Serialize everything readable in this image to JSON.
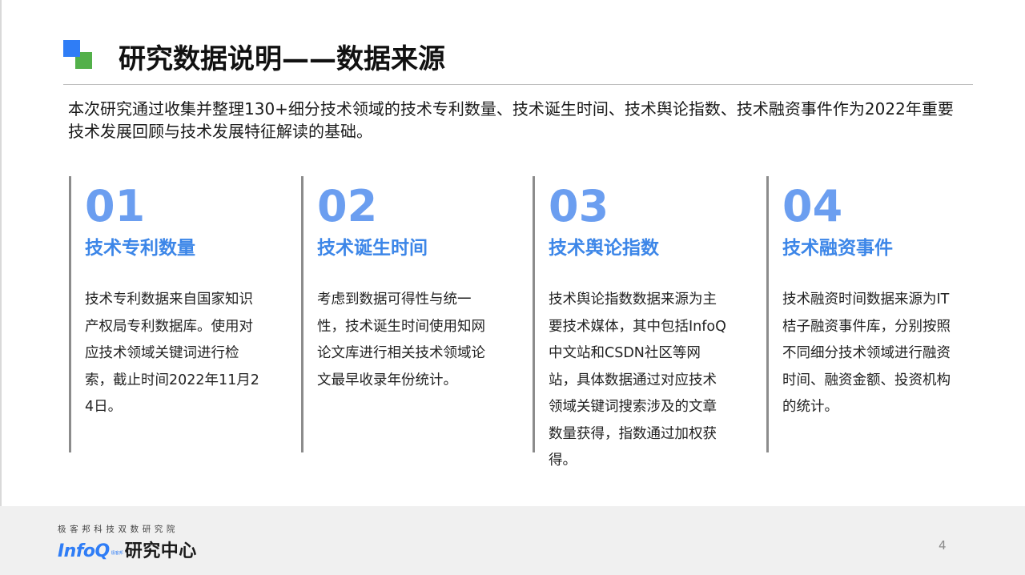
{
  "header": {
    "title": "研究数据说明——数据来源"
  },
  "intro": "本次研究通过收集并整理130+细分技术领域的技术专利数量、技术诞生时间、技术舆论指数、技术融资事件作为2022年重要技术发展回顾与技术发展特征解读的基础。",
  "columns": [
    {
      "number": "01",
      "heading": "技术专利数量",
      "text": "技术专利数据来自国家知识产权局专利数据库。使用对应技术领域关键词进行检索，截止时间2022年11月24日。"
    },
    {
      "number": "02",
      "heading": "技术诞生时间",
      "text": "考虑到数据可得性与统一性，技术诞生时间使用知网论文库进行相关技术领域论文最早收录年份统计。"
    },
    {
      "number": "03",
      "heading": "技术舆论指数",
      "text": "技术舆论指数数据来源为主要技术媒体，其中包括InfoQ中文站和CSDN社区等网站，具体数据通过对应技术领域关键词搜索涉及的文章数量获得，指数通过加权获得。"
    },
    {
      "number": "04",
      "heading": "技术融资事件",
      "text": "技术融资时间数据来源为IT桔子融资事件库，分别按照不同细分技术领域进行融资时间、融资金额、投资机构的统计。"
    }
  ],
  "footer": {
    "org": "极客邦科技双数研究院",
    "logo_brand": "InfoQ",
    "logo_small": "极客邦",
    "logo_cn": "研究中心",
    "page_number": "4"
  },
  "colors": {
    "accent_blue": "#2f7df6",
    "accent_green": "#53b04a",
    "number_blue": "#6b9ef0",
    "heading_blue": "#3c86e8"
  }
}
